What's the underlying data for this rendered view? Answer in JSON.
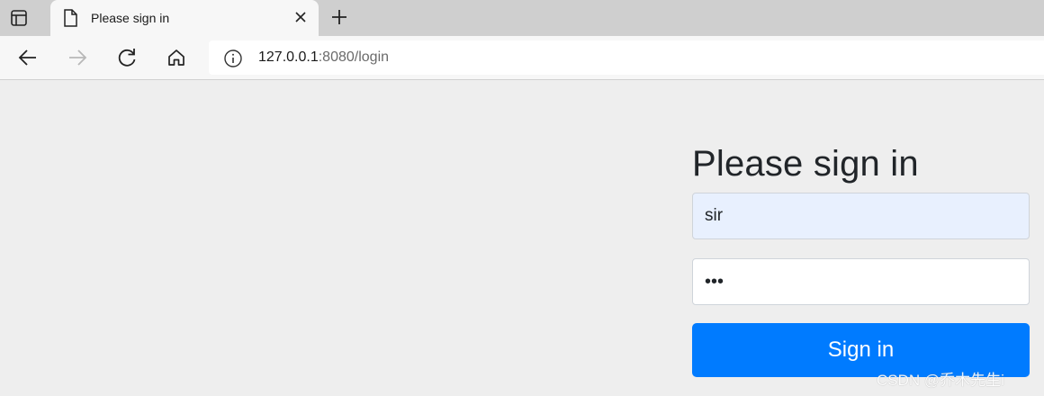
{
  "browser": {
    "tab": {
      "title": "Please sign in"
    },
    "address": {
      "host": "127.0.0.1",
      "path": ":8080/login"
    }
  },
  "form": {
    "heading": "Please sign in",
    "username": {
      "value": "sir"
    },
    "password": {
      "value": "•••"
    },
    "submit_label": "Sign in"
  },
  "watermark": "CSDN @乔木先生i",
  "colors": {
    "accent": "#007bff",
    "page_bg": "#eeeeee",
    "autofill_bg": "#e8f0fe"
  },
  "icons": [
    "tab-actions-icon",
    "page-icon",
    "close-icon",
    "plus-icon",
    "back-arrow-icon",
    "forward-arrow-icon",
    "reload-icon",
    "home-icon",
    "info-icon"
  ]
}
